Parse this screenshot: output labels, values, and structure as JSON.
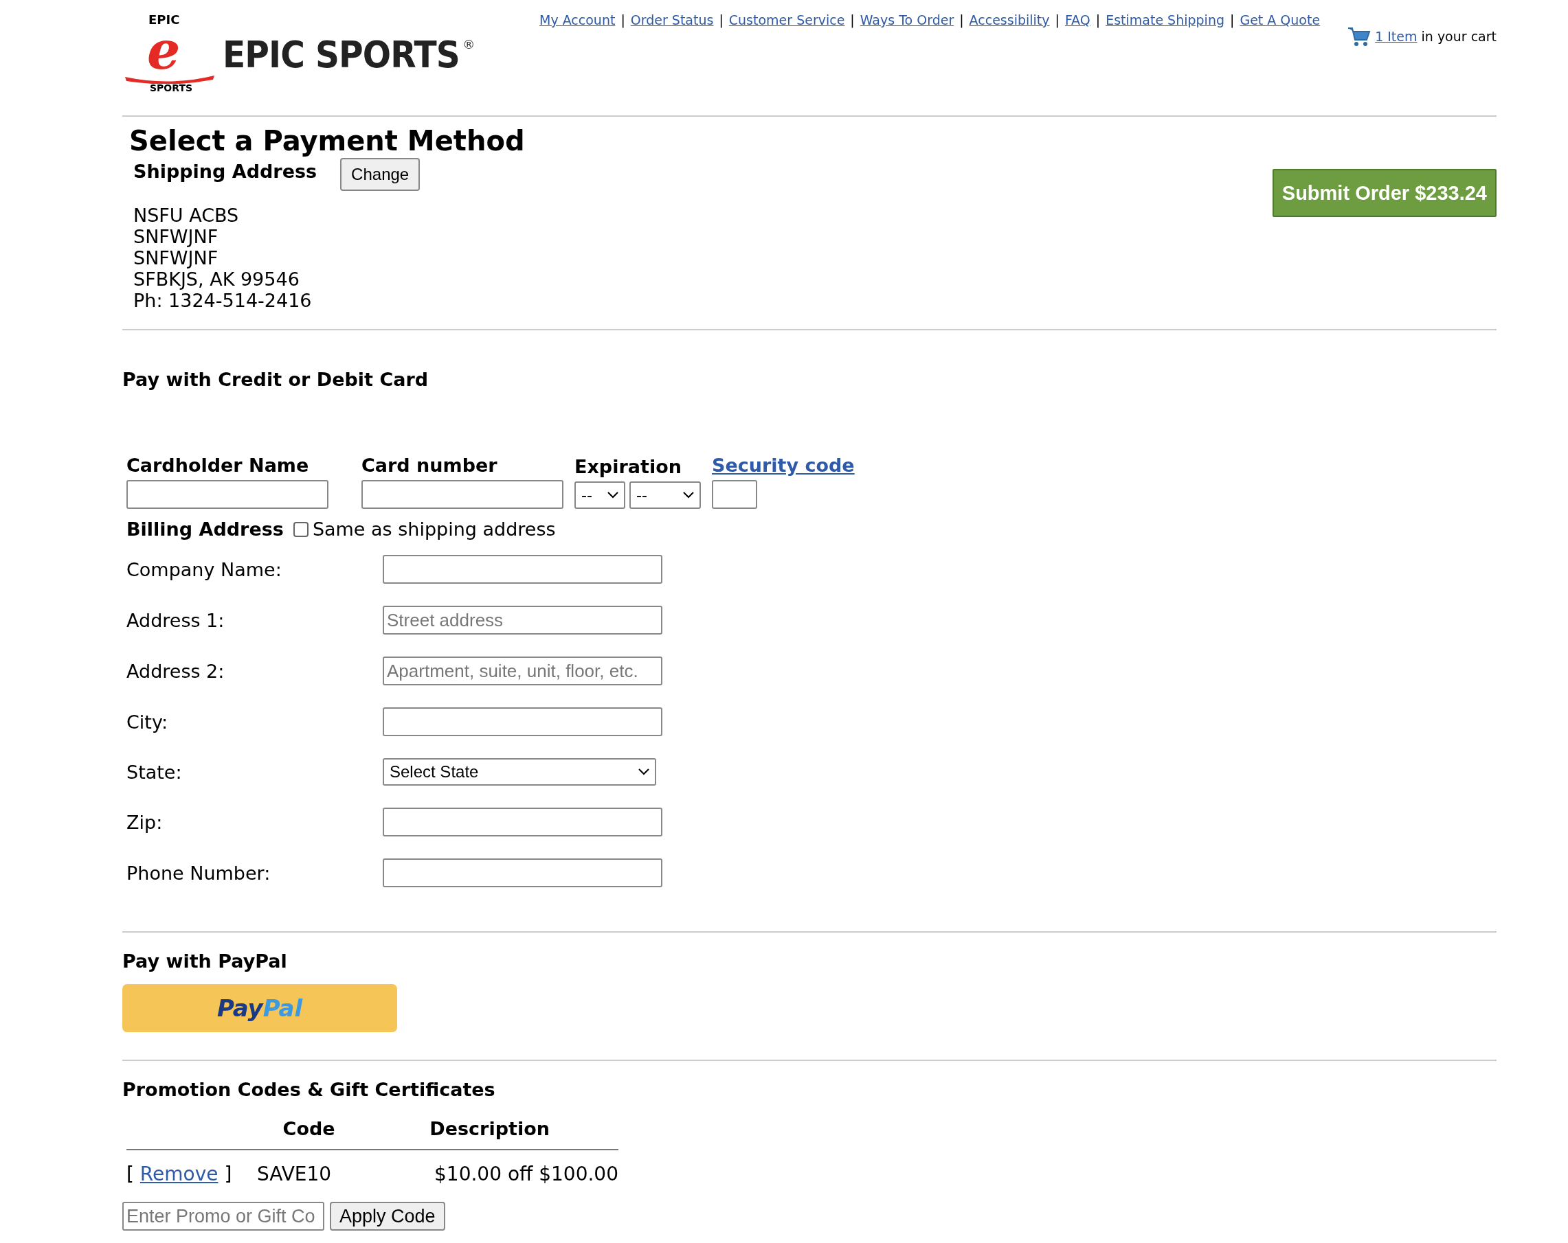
{
  "header": {
    "logo": {
      "ring_top": "EPIC",
      "letter": "e",
      "ring_bottom": "SPORTS",
      "wordmark": "EPIC SPORTS",
      "registered": "®"
    },
    "nav_links": [
      "My Account",
      "Order Status",
      "Customer Service",
      "Ways To Order",
      "Accessibility",
      "FAQ",
      "Estimate Shipping",
      "Get A Quote"
    ],
    "separator": "|",
    "cart": {
      "link": "1 Item",
      "text": "in your cart"
    }
  },
  "page_title": "Select a Payment Method",
  "shipping": {
    "heading": "Shipping Address",
    "change_button": "Change",
    "address_lines": [
      "NSFU ACBS",
      "SNFWJNF",
      "SNFWJNF",
      "SFBKJS, AK 99546",
      "Ph: 1324-514-2416"
    ]
  },
  "submit_button": "Submit Order $233.24",
  "card_section": {
    "heading": "Pay with Credit or Debit Card",
    "cardholder_label": "Cardholder Name",
    "card_number_label": "Card number",
    "expiration_label": "Expiration",
    "expiration_month": "--",
    "expiration_year": "--",
    "security_code_link": "Security code"
  },
  "billing": {
    "heading": "Billing Address",
    "same_as_shipping": {
      "label": "Same as shipping address",
      "checked": false
    },
    "rows": [
      {
        "label": "Company Name:",
        "kind": "input"
      },
      {
        "label": "Address 1:",
        "kind": "input",
        "placeholder": "Street address"
      },
      {
        "label": "Address 2:",
        "kind": "input",
        "placeholder": "Apartment, suite, unit, floor, etc."
      },
      {
        "label": "City:",
        "kind": "input"
      },
      {
        "label": "State:",
        "kind": "select",
        "value": "Select State"
      },
      {
        "label": "Zip:",
        "kind": "input"
      },
      {
        "label": "Phone Number:",
        "kind": "input"
      }
    ]
  },
  "paypal": {
    "heading": "Pay with PayPal",
    "button_part_1": "Pay",
    "button_part_2": "Pal"
  },
  "promo": {
    "heading": "Promotion Codes & Gift Certificates",
    "columns": [
      "Code",
      "Description"
    ],
    "rows": [
      {
        "open_bracket": "[",
        "action_link": "Remove",
        "close_bracket": "]",
        "code": "SAVE10",
        "description": "$10.00 off $100.00"
      }
    ],
    "input_placeholder": "Enter Promo or Gift Co",
    "apply_button": "Apply Code"
  }
}
